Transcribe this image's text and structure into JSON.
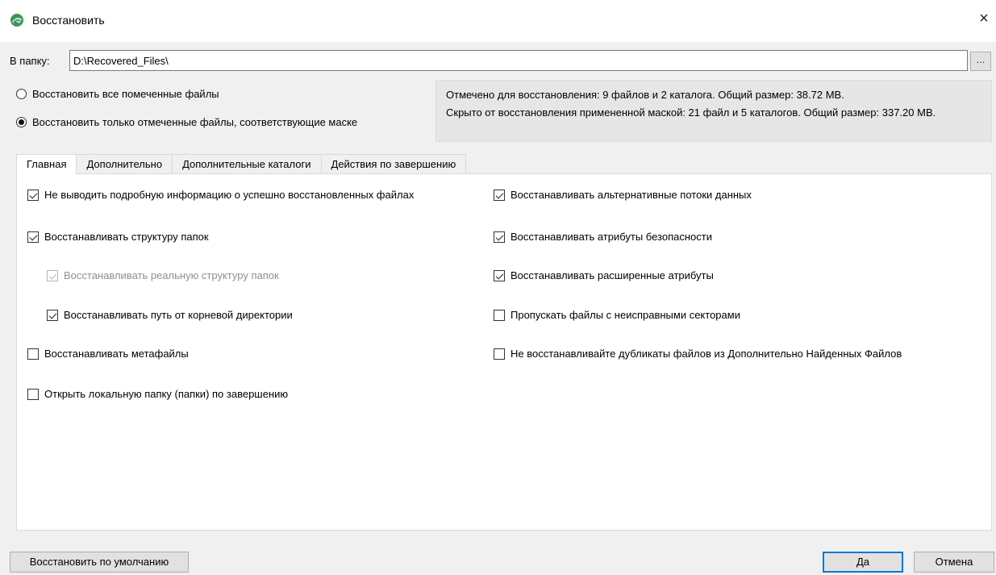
{
  "window": {
    "title": "Восстановить",
    "close_glyph": "×",
    "icon": "app-recovery-icon"
  },
  "folder": {
    "label": "В папку:",
    "value": "D:\\Recovered_Files\\",
    "browse_label": "..."
  },
  "radios": [
    {
      "label": "Восстановить все помеченные файлы",
      "checked": false
    },
    {
      "label": "Восстановить только отмеченные файлы, соответствующие маске",
      "checked": true
    }
  ],
  "info": {
    "line1": "Отмечено для восстановления: 9 файлов и 2 каталога. Общий размер: 38.72 MB.",
    "line2": "Скрыто от восстановления примененной маской: 21 файл и 5 каталогов. Общий размер: 337.20 MB."
  },
  "tabs": [
    {
      "label": "Главная",
      "active": true
    },
    {
      "label": "Дополнительно",
      "active": false
    },
    {
      "label": "Дополнительные каталоги",
      "active": false
    },
    {
      "label": "Действия по завершению",
      "active": false
    }
  ],
  "options_left": [
    {
      "label": "Не выводить подробную информацию о успешно восстановленных файлах",
      "checked": true,
      "disabled": false
    },
    {
      "label": "Восстанавливать структуру папок",
      "checked": true,
      "disabled": false
    },
    {
      "label": "Восстанавливать реальную структуру папок",
      "checked": true,
      "disabled": true
    },
    {
      "label": "Восстанавливать путь от корневой директории",
      "checked": true,
      "disabled": false
    },
    {
      "label": "Восстанавливать метафайлы",
      "checked": false,
      "disabled": false
    },
    {
      "label": "Открыть локальную папку (папки) по завершению",
      "checked": false,
      "disabled": false
    }
  ],
  "options_right": [
    {
      "label": "Восстанавливать альтернативные потоки данных",
      "checked": true
    },
    {
      "label": "Восстанавливать атрибуты безопасности",
      "checked": true
    },
    {
      "label": "Восстанавливать расширенные атрибуты",
      "checked": true
    },
    {
      "label": "Пропускать файлы с неисправными секторами",
      "checked": false
    },
    {
      "label": "Не восстанавливайте дубликаты файлов из Дополнительно Найденных Файлов",
      "checked": false
    }
  ],
  "buttons": {
    "defaults": "Восстановить по умолчанию",
    "ok": "Да",
    "cancel": "Отмена"
  }
}
